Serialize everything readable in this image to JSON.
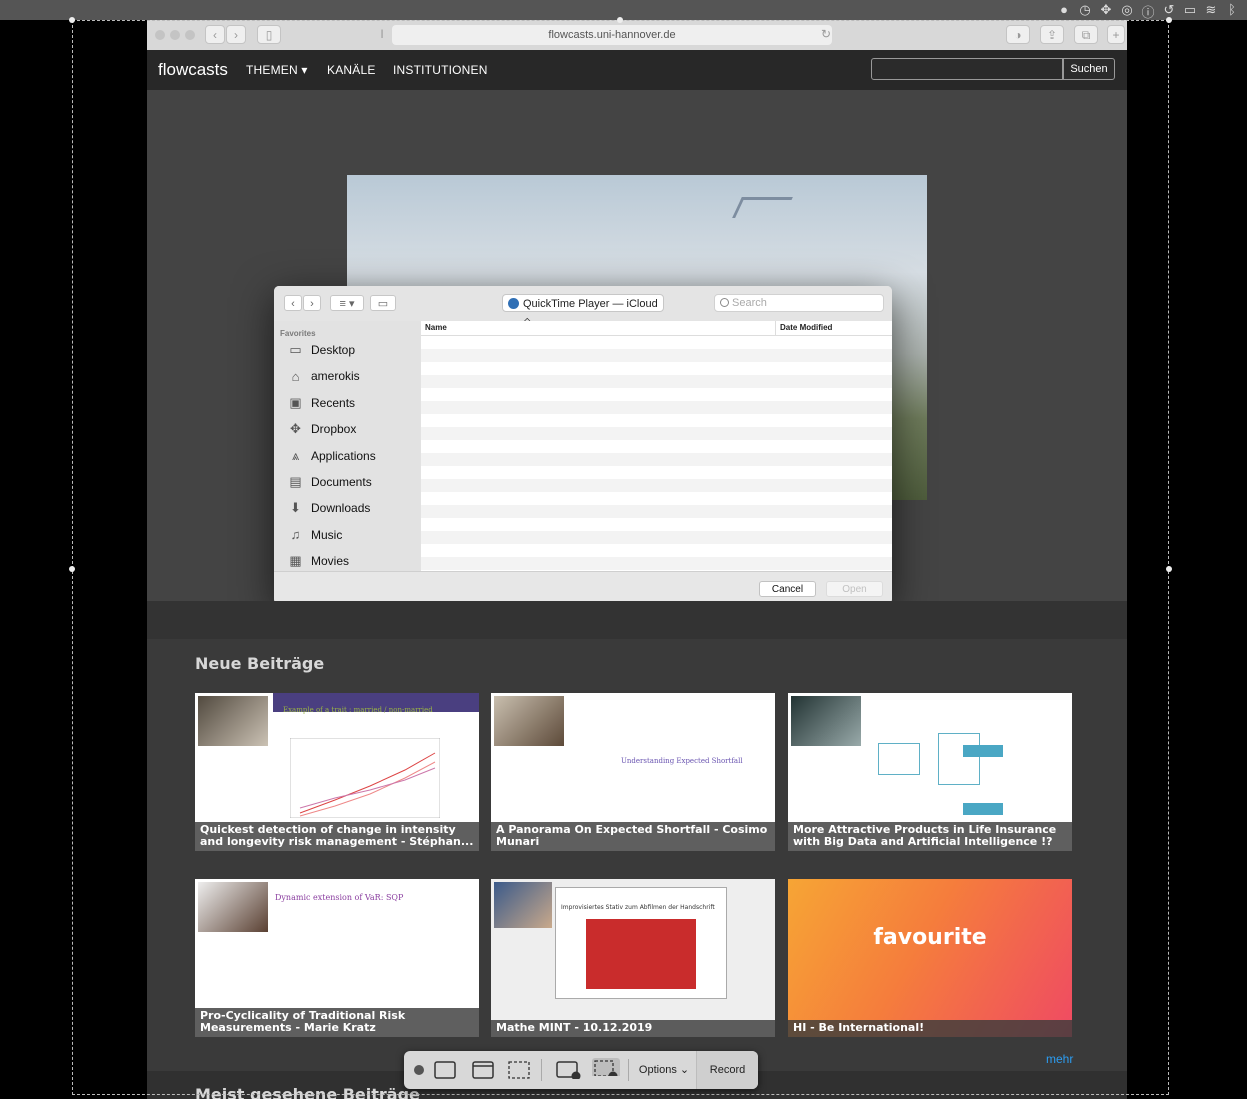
{
  "browser": {
    "url": "flowcasts.uni-hannover.de"
  },
  "site": {
    "brand": "flowcasts",
    "nav": [
      "THEMEN ▾",
      "KANÄLE",
      "INSTITUTIONEN"
    ],
    "search_button": "Suchen",
    "search_placeholder": ""
  },
  "dialog": {
    "location": "QuickTime Player — iCloud ◇",
    "search_placeholder": "Search",
    "sidebar_heading": "Favorites",
    "favorites": [
      {
        "label": "Desktop",
        "icon": "desktop-icon"
      },
      {
        "label": "amerokis",
        "icon": "home-icon"
      },
      {
        "label": "Recents",
        "icon": "recents-icon"
      },
      {
        "label": "Dropbox",
        "icon": "dropbox-icon"
      },
      {
        "label": "Applications",
        "icon": "applications-icon"
      },
      {
        "label": "Documents",
        "icon": "documents-icon"
      },
      {
        "label": "Downloads",
        "icon": "downloads-icon"
      },
      {
        "label": "Music",
        "icon": "music-icon"
      },
      {
        "label": "Movies",
        "icon": "movies-icon"
      }
    ],
    "columns": [
      "Name",
      "Date Modified"
    ],
    "cancel": "Cancel",
    "open": "Open"
  },
  "sections": {
    "neue": "Neue Beiträge",
    "meist": "Meist gesehene Beiträge",
    "mehr": "mehr"
  },
  "cards": [
    {
      "title": "Quickest detection of change in intensity and longevity risk management - Stéphan...",
      "slide_heading": "Example of a trait : married / non-married"
    },
    {
      "title": "A Panorama On Expected Shortfall - Cosimo Munari",
      "slide_heading": "Understanding Expected Shortfall"
    },
    {
      "title": "More Attractive Products in Life Insurance with Big Data and Artificial Intelligence !? ...",
      "slide_heading": ""
    },
    {
      "title": "Pro-Cyclicality of Traditional Risk Measurements - Marie Kratz",
      "slide_heading": "Dynamic extension of VaR: SQP"
    },
    {
      "title": "Mathe MINT - 10.12.2019",
      "slide_heading": "Improvisiertes Stativ zum Abfilmen der Handschrift"
    },
    {
      "title": "HI - Be International!",
      "slide_heading": "favourite"
    }
  ],
  "capture_toolbar": {
    "options": "Options ⌄",
    "record": "Record"
  },
  "colors": {
    "page_bg": "#3a3a3a",
    "link": "#2c9df2",
    "favourite_gradient_start": "#f6a535",
    "favourite_gradient_end": "#ef4a63"
  }
}
